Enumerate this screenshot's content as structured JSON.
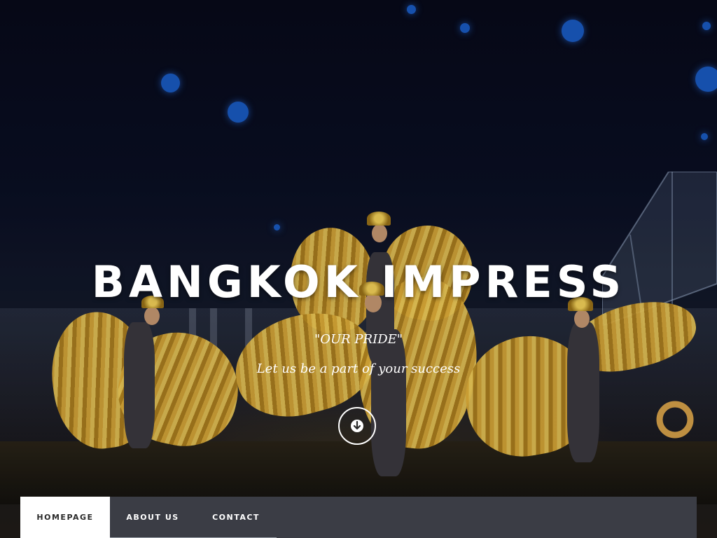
{
  "hero": {
    "title": "BANGKOK IMPRESS",
    "subtitle": "\"OUR PRIDE\"",
    "tagline": "Let us be a part of your success",
    "scroll_icon": "arrow-down-circle-icon"
  },
  "nav": {
    "items": [
      {
        "label": "HOMEPAGE",
        "active": true
      },
      {
        "label": "ABOUT US",
        "active": false
      },
      {
        "label": "CONTACT",
        "active": false
      }
    ]
  },
  "colors": {
    "nav_background": "#3b3d45",
    "nav_active_background": "#ffffff",
    "title_text": "#ffffff",
    "accent_gold": "#e5b23a"
  }
}
